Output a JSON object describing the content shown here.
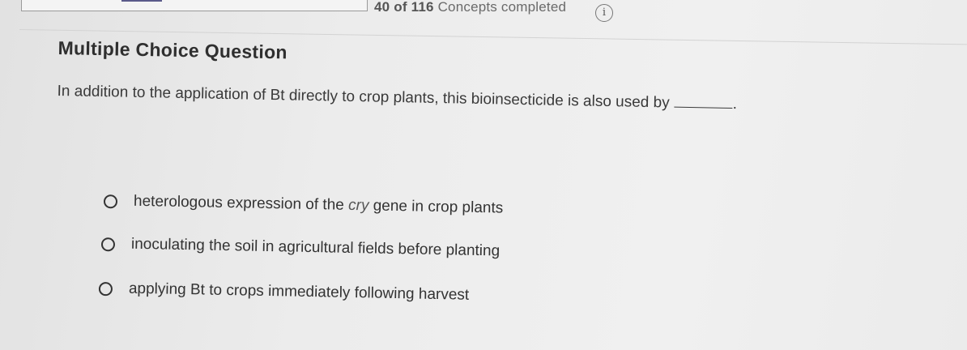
{
  "progress": {
    "completed_text": "40 of 116",
    "label": "Concepts completed",
    "info_icon": "info-icon"
  },
  "question": {
    "header": "Multiple Choice Question",
    "stem": "In addition to the application of Bt directly to crop plants, this bioinsecticide is also used by",
    "stem_end": "."
  },
  "options": [
    {
      "before": "heterologous expression of the ",
      "italic": "cry",
      "after": " gene in crop plants"
    },
    {
      "text": "inoculating the soil in agricultural fields before planting"
    },
    {
      "text": "applying Bt to crops immediately following harvest"
    }
  ],
  "colors": {
    "background": "#ececec",
    "text": "#2b2b2b",
    "progress_fill": "#5b5b8a"
  }
}
